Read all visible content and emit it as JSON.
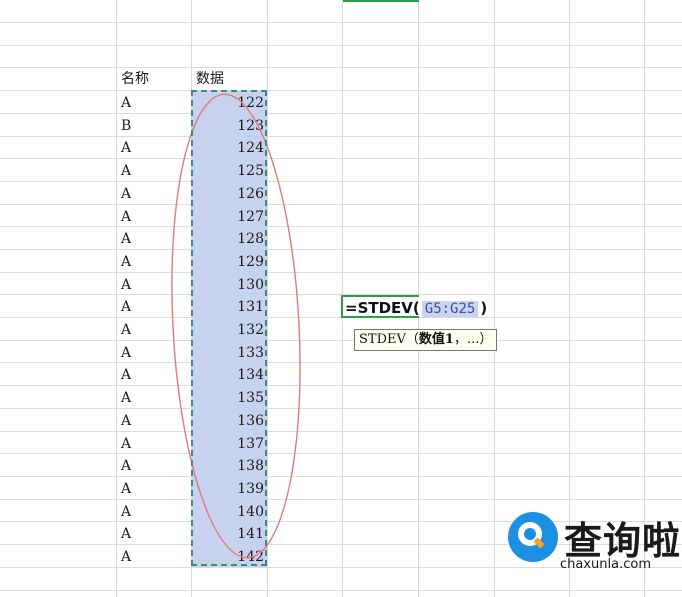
{
  "sheet": {
    "header": {
      "name": "名称",
      "data": "数据"
    },
    "rows": [
      {
        "name": "A",
        "value": "122"
      },
      {
        "name": "B",
        "value": "123"
      },
      {
        "name": "A",
        "value": "124"
      },
      {
        "name": "A",
        "value": "125"
      },
      {
        "name": "A",
        "value": "126"
      },
      {
        "name": "A",
        "value": "127"
      },
      {
        "name": "A",
        "value": "128"
      },
      {
        "name": "A",
        "value": "129"
      },
      {
        "name": "A",
        "value": "130"
      },
      {
        "name": "A",
        "value": "131"
      },
      {
        "name": "A",
        "value": "132"
      },
      {
        "name": "A",
        "value": "133"
      },
      {
        "name": "A",
        "value": "134"
      },
      {
        "name": "A",
        "value": "135"
      },
      {
        "name": "A",
        "value": "136"
      },
      {
        "name": "A",
        "value": "137"
      },
      {
        "name": "A",
        "value": "138"
      },
      {
        "name": "A",
        "value": "139"
      },
      {
        "name": "A",
        "value": "140"
      },
      {
        "name": "A",
        "value": "141"
      },
      {
        "name": "A",
        "value": "142"
      }
    ]
  },
  "formula": {
    "prefix": "=STDEV(",
    "range_ref": "G5:G25",
    "suffix": ")"
  },
  "tooltip": {
    "func": "STDEV（",
    "arg": "数值1",
    "rest": "，...）"
  },
  "watermark": {
    "title": "查询啦",
    "domain": "chaxunla.com"
  },
  "colors": {
    "selection_fill": "#c7d3ee",
    "selection_border": "#3e8a7e",
    "active_cell_border": "#2e9d47",
    "annotation_ellipse": "#e07b7b",
    "watermark_blue": "#1d8fe1"
  }
}
